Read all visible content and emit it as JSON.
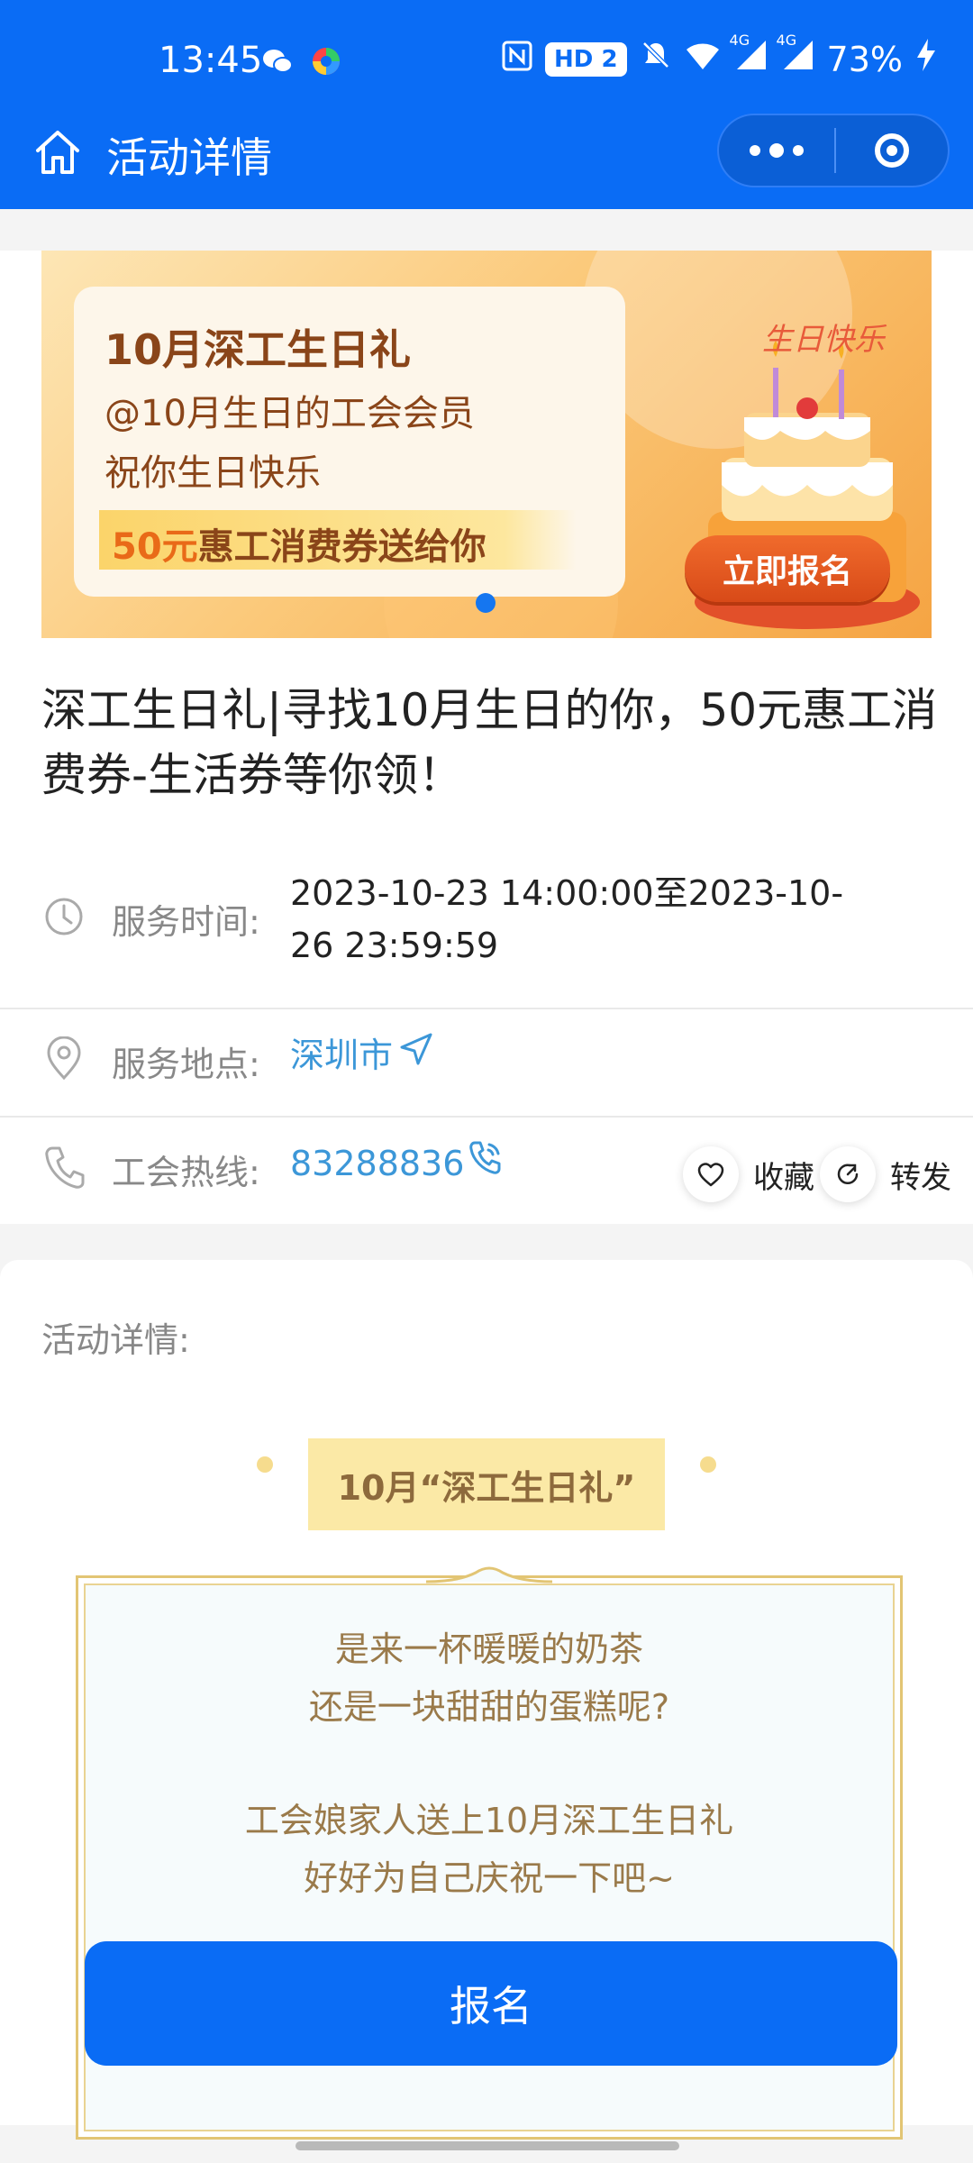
{
  "status_bar": {
    "time": "13:45",
    "hd_badge": "HD 2",
    "network_1": "4G",
    "network_2": "4G",
    "battery": "73%"
  },
  "nav": {
    "title": "活动详情"
  },
  "banner": {
    "headline": "10月深工生日礼",
    "line2": "@10月生日的工会会员",
    "line3": "祝你生日快乐",
    "highlight_accent": "50元",
    "highlight_rest": "惠工消费券送给你",
    "cake_text": "生日快乐",
    "button": "立即报名"
  },
  "activity": {
    "title": "深工生日礼|寻找10月生日的你，50元惠工消费券-生活券等你领！",
    "service_time_label": "服务时间:",
    "service_time_value": "2023-10-23 14:00:00至2023-10-26 23:59:59",
    "location_label": "服务地点:",
    "location_value": "深圳市",
    "hotline_label": "工会热线:",
    "hotline_value": "83288836",
    "favorite": "收藏",
    "share": "转发"
  },
  "details": {
    "label": "活动详情:",
    "tag": "10月“深工生日礼”",
    "lines": [
      "是来一杯暖暖的奶茶",
      "还是一块甜甜的蛋糕呢?",
      "工会娘家人送上10月深工生日礼",
      "好好为自己庆祝一下吧~"
    ]
  },
  "cta": {
    "label": "报名"
  },
  "colors": {
    "brand_blue": "#0a6cf5",
    "link_blue": "#3c97d8",
    "banner_orange": "#f5a443"
  }
}
